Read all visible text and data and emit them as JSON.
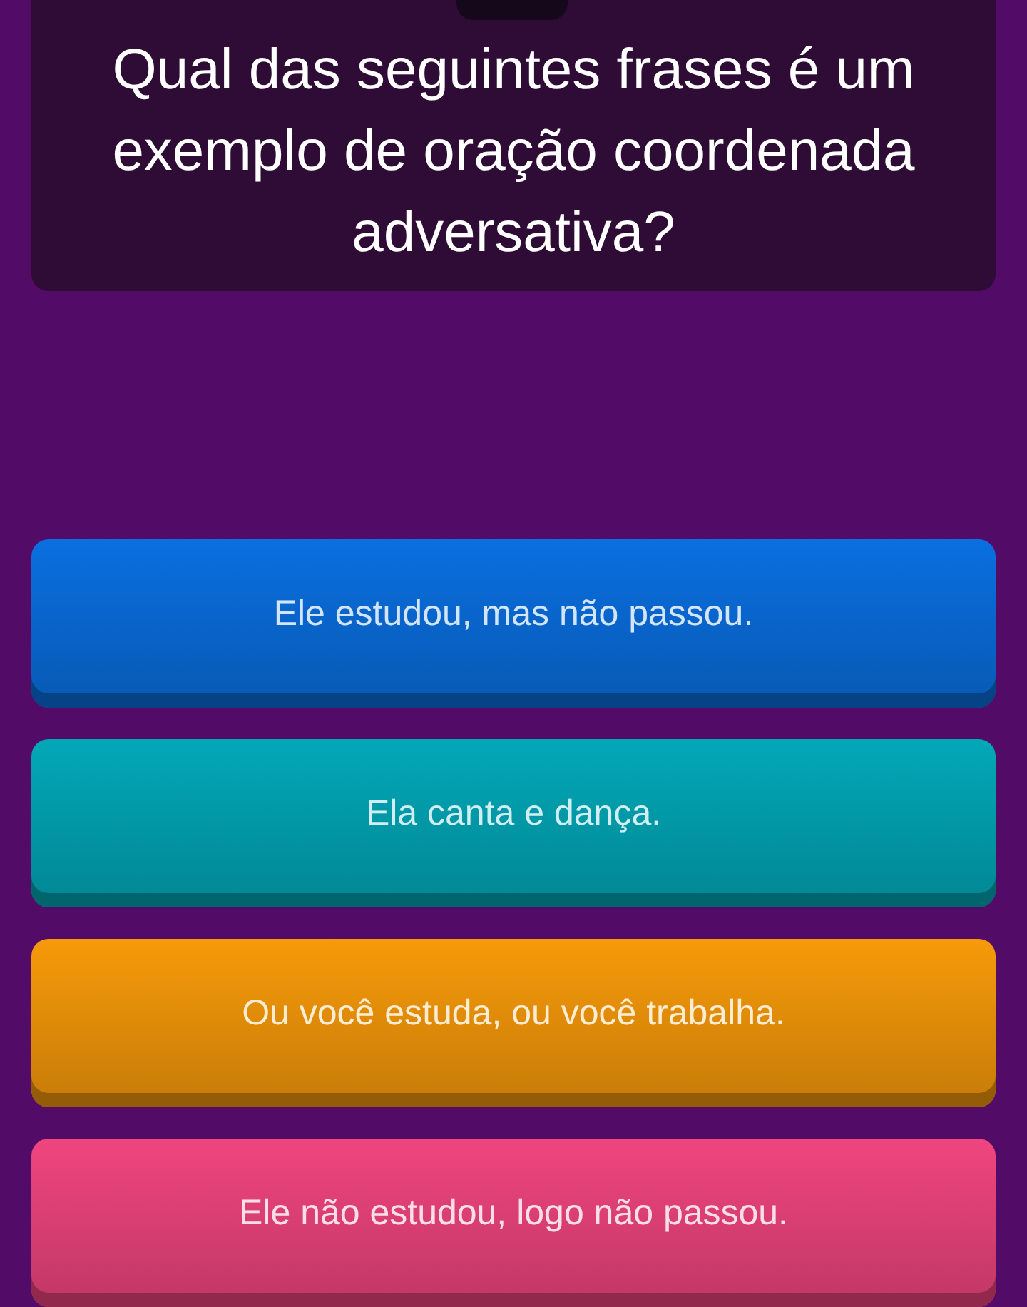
{
  "question": "Qual das seguintes frases é um exemplo de oração coordenada adversativa?",
  "options": [
    {
      "text": "Ele estudou, mas não passou.",
      "color": "#0a6fe0"
    },
    {
      "text": "Ela canta e dança.",
      "color": "#02a8b8"
    },
    {
      "text": "Ou você estuda, ou você trabalha.",
      "color": "#f79a0a"
    },
    {
      "text": "Ele não estudou, logo não passou.",
      "color": "#f0457f"
    }
  ]
}
